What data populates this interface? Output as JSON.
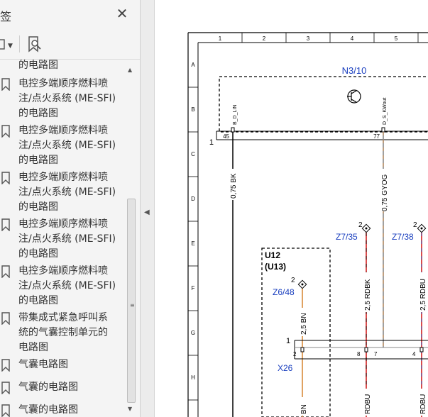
{
  "bookmarks_panel": {
    "title": "签",
    "close_glyph": "✕",
    "toolbar": {
      "options_icon": "bookmark-options-icon",
      "find_icon": "find-bookmark-icon"
    },
    "items": [
      {
        "label": "的电路图"
      },
      {
        "label": "电控多端顺序燃料喷\n注/点火系统 (ME-SFI)\n的电路图"
      },
      {
        "label": "电控多端顺序燃料喷\n注/点火系统 (ME-SFI)\n的电路图"
      },
      {
        "label": "电控多端顺序燃料喷\n注/点火系统 (ME-SFI)\n的电路图"
      },
      {
        "label": "电控多端顺序燃料喷\n注/点火系统 (ME-SFI)\n的电路图"
      },
      {
        "label": "电控多端顺序燃料喷\n注/点火系统 (ME-SFI)\n的电路图"
      },
      {
        "label": "带集成式紧急呼叫系\n统的气囊控制单元的\n电路图"
      },
      {
        "label": "气囊电路图"
      },
      {
        "label": "气囊的电路图"
      },
      {
        "label": "气囊的电路图"
      }
    ]
  },
  "schematic": {
    "columns": [
      "1",
      "2",
      "3",
      "4",
      "5"
    ],
    "rows": [
      "A",
      "B",
      "C",
      "D",
      "E",
      "F",
      "G",
      "H"
    ],
    "module_n3": "N3/10",
    "pin_b_d_lin": "B_D_LIN",
    "pin_d_s_kwout": "D_S_KWout",
    "pin_45": "45",
    "pin_77": "77",
    "conn_1_top": "1",
    "wire_bk": "0,75 BK",
    "wire_gyog": "0,75 GYOG",
    "z735_id": "Z7/35",
    "z735_pin": "2",
    "z738_id": "Z7/38",
    "z738_pin": "2",
    "u12": "U12",
    "u13": "(U13)",
    "z648_id": "Z6/48",
    "z648_pin": "2",
    "wire_bn": "2,5 BN",
    "wire_rdbk": "2,5 RDBK",
    "wire_rdbu": "2,5 RDBU",
    "x26": "X26",
    "x26_pin1": "1",
    "x26_pin2": "2",
    "x26_pin8": "8",
    "x26_pin7": "7",
    "x26_pin4": "4",
    "wire_bn_low": "BN",
    "wire_rdbu_low1": "RDBU",
    "wire_rdbu_low2": "RDBU"
  },
  "colors": {
    "wire_gray": "#888888",
    "wire_orange": "#d98a3a",
    "wire_red": "#d02020",
    "wire_blue": "#2050c0",
    "label_blue": "#1a3fbf",
    "gnd_green": "#4a9a2a"
  }
}
